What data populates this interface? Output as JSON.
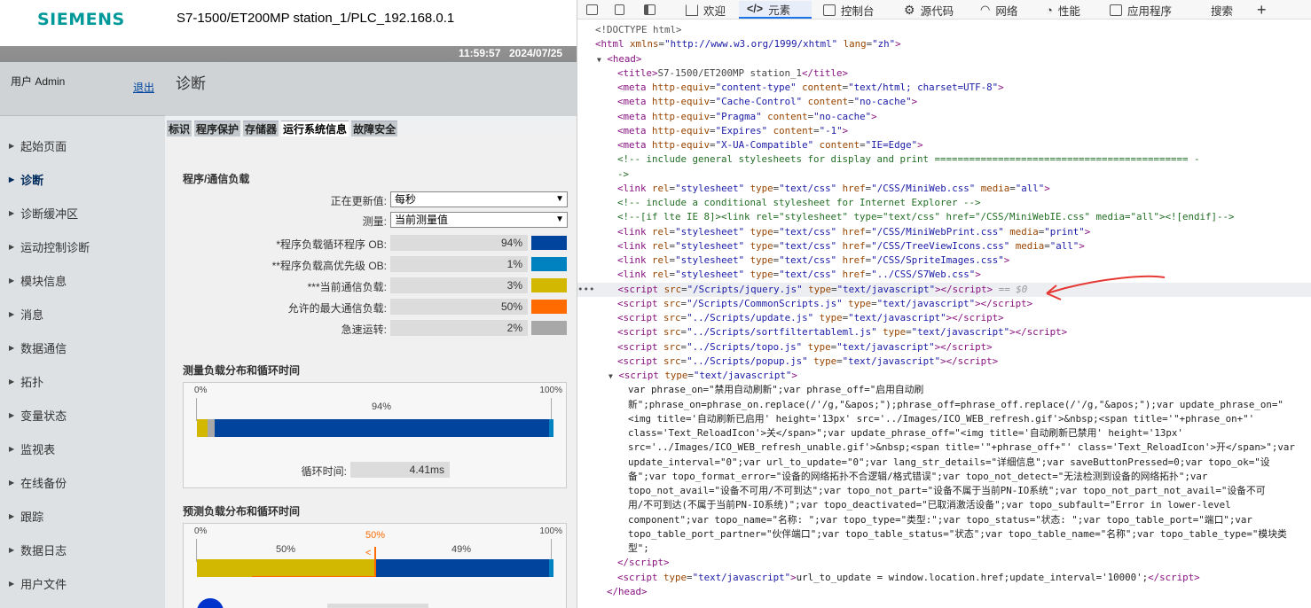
{
  "header": {
    "logo": "SIEMENS",
    "station": "S7-1500/ET200MP station_1/PLC_192.168.0.1",
    "time": "11:59:57",
    "date": "2024/07/25"
  },
  "sidebar": {
    "user": "用户 Admin",
    "logout": "退出",
    "items": [
      {
        "label": "起始页面"
      },
      {
        "label": "诊断"
      },
      {
        "label": "诊断缓冲区"
      },
      {
        "label": "运动控制诊断"
      },
      {
        "label": "模块信息"
      },
      {
        "label": "消息"
      },
      {
        "label": "数据通信"
      },
      {
        "label": "拓扑"
      },
      {
        "label": "变量状态"
      },
      {
        "label": "监视表"
      },
      {
        "label": "在线备份"
      },
      {
        "label": "跟踪"
      },
      {
        "label": "数据日志"
      },
      {
        "label": "用户文件"
      }
    ]
  },
  "main": {
    "title": "诊断",
    "tabs": [
      "标识",
      "程序保护",
      "存储器",
      "运行系统信息",
      "故障安全"
    ],
    "section1": "程序/通信负载",
    "update_label": "正在更新值:",
    "update_value": "每秒",
    "measure_label": "测量:",
    "measure_value": "当前测量值",
    "loads": [
      {
        "label": "*程序负载循环程序 OB:",
        "value": "94%",
        "color": "#00449e"
      },
      {
        "label": "**程序负载高优先级 OB:",
        "value": "1%",
        "color": "#0082c0"
      },
      {
        "label": "***当前通信负载:",
        "value": "3%",
        "color": "#d2b800"
      },
      {
        "label": "允许的最大通信负载:",
        "value": "50%",
        "color": "#ff6b00"
      },
      {
        "label": "急速运转:",
        "value": "2%",
        "color": "#a8a8a8"
      }
    ],
    "section2": "测量负载分布和循环时间",
    "pct0": "0%",
    "pct100": "100%",
    "bar1_label": "94%",
    "cycle_label": "循环时间:",
    "cycle_value": "4.41ms",
    "section3": "预测负载分布和循环时间",
    "max_comm": "50%",
    "pred_left": "50%",
    "pred_right": "49%"
  },
  "devtools": {
    "tabs": [
      "欢迎",
      "元素",
      "控制台",
      "源代码",
      "网络",
      "性能",
      "应用程序",
      "搜索"
    ],
    "active_tab": "元素"
  }
}
